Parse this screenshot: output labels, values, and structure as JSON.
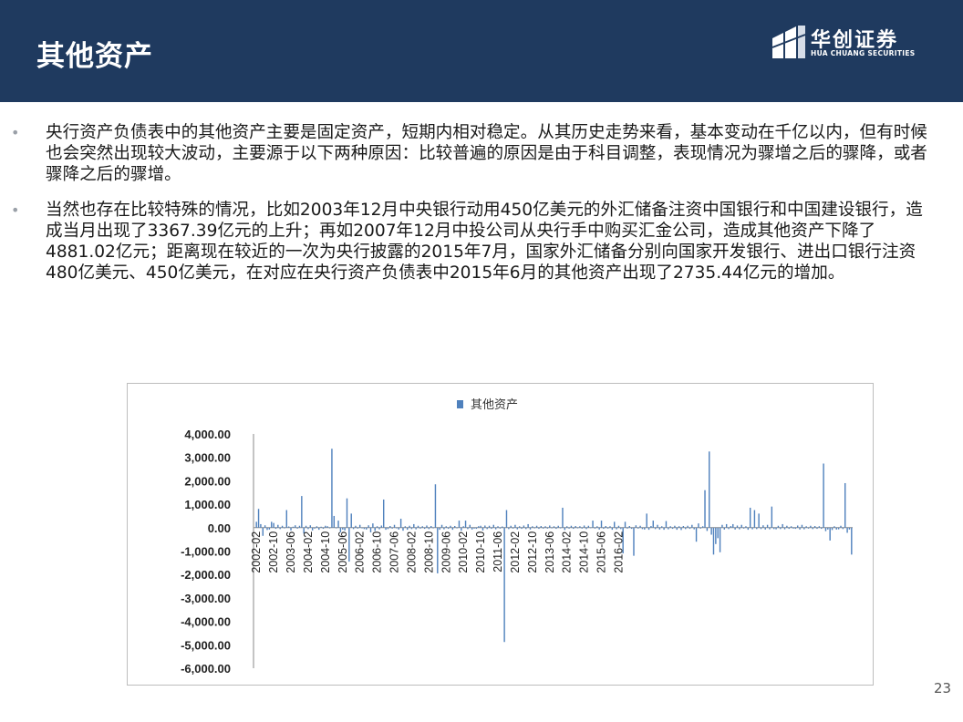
{
  "header": {
    "title": "其他资产",
    "logo_cn": "华创证券",
    "logo_en": "HUA CHUANG SECURITIES",
    "bg_color": "#1f3a5f"
  },
  "bullets": [
    {
      "text": "央行资产负债表中的其他资产主要是固定资产，短期内相对稳定。从其历史走势来看，基本变动在千亿以内，但有时候也会突然出现较大波动，主要源于以下两种原因：比较普遍的原因是由于科目调整，表现情况为骤增之后的骤降，或者骤降之后的骤增。"
    },
    {
      "text": "当然也存在比较特殊的情况，比如2003年12月中央银行动用450亿美元的外汇储备注资中国银行和中国建设银行，造成当月出现了3367.39亿元的上升；再如2007年12月中投公司从央行手中购买汇金公司，造成其他资产下降了4881.02亿元；距离现在较近的一次为央行披露的2015年7月，国家外汇储备分别向国家开发银行、进出口银行注资480亿美元、450亿美元，在对应在央行资产负债表中2015年6月的其他资产出现了2735.44亿元的增加。"
    }
  ],
  "page_number": "23",
  "chart_data": {
    "type": "bar",
    "title": "",
    "legend": [
      "其他资产"
    ],
    "legend_position": "top-center",
    "color": "#4f81bd",
    "grid": false,
    "ylim": [
      -6000,
      4000
    ],
    "yticks": [
      "4,000.00",
      "3,000.00",
      "2,000.00",
      "1,000.00",
      "0.00",
      "-1,000.00",
      "-2,000.00",
      "-3,000.00",
      "-4,000.00",
      "-5,000.00",
      "-6,000.00"
    ],
    "ytick_values": [
      4000,
      3000,
      2000,
      1000,
      0,
      -1000,
      -2000,
      -3000,
      -4000,
      -5000,
      -6000
    ],
    "x_start": "2002-02",
    "x_tick_labels": [
      "2002-02",
      "2002-10",
      "2003-06",
      "2004-02",
      "2004-10",
      "2005-06",
      "2006-02",
      "2006-10",
      "2007-06",
      "2008-02",
      "2008-10",
      "2009-06",
      "2010-02",
      "2010-10",
      "2011-06",
      "2012-02",
      "2012-10",
      "2013-06",
      "2014-02",
      "2014-10",
      "2015-06",
      "2016-02"
    ],
    "series": [
      {
        "name": "其他资产",
        "values": [
          250,
          800,
          150,
          -350,
          100,
          -100,
          -80,
          250,
          200,
          -50,
          120,
          -60,
          80,
          -30,
          750,
          50,
          -120,
          40,
          100,
          -40,
          80,
          1350,
          -250,
          80,
          -60,
          100,
          -120,
          -40,
          60,
          -90,
          40,
          -50,
          80,
          60,
          -30,
          3367.39,
          500,
          -30,
          300,
          -200,
          -80,
          -120,
          1250,
          -1450,
          600,
          -60,
          80,
          -40,
          120,
          -30,
          -60,
          -80,
          100,
          -200,
          180,
          -140,
          60,
          -70,
          90,
          1200,
          -90,
          -60,
          70,
          -40,
          120,
          -30,
          -80,
          380,
          -130,
          60,
          -90,
          80,
          -60,
          150,
          -70,
          80,
          -40,
          60,
          -50,
          90,
          -60,
          70,
          -30,
          1850,
          -1950,
          -90,
          120,
          -70,
          60,
          -50,
          80,
          -90,
          70,
          -30,
          300,
          -130,
          60,
          300,
          -60,
          120,
          -80,
          -40,
          -50,
          60,
          80,
          -120,
          90,
          -60,
          80,
          -50,
          120,
          -70,
          60,
          -40,
          50,
          -4881.02,
          750,
          -60,
          80,
          -40,
          120,
          -70,
          60,
          -50,
          90,
          -60,
          150,
          -80,
          60,
          -30,
          80,
          -50,
          70,
          -40,
          60,
          -40,
          90,
          -30,
          60,
          -50,
          80,
          -30,
          850,
          -100,
          60,
          -40,
          80,
          -50,
          70,
          -30,
          60,
          -40,
          90,
          -60,
          80,
          -20,
          300,
          -40,
          60,
          -80,
          300,
          -50,
          70,
          -40,
          60,
          -90,
          250,
          -70,
          80,
          -60,
          -1100,
          250,
          -40,
          70,
          -50,
          -1200,
          100,
          -40,
          80,
          -60,
          -80,
          600,
          -90,
          70,
          300,
          -60,
          120,
          -80,
          60,
          -90,
          280,
          -70,
          60,
          -50,
          80,
          -90,
          60,
          -100,
          70,
          -60,
          80,
          -50,
          120,
          -70,
          -600,
          180,
          -40,
          60,
          1600,
          -140,
          3250,
          -300,
          -1150,
          -700,
          -450,
          -1050,
          120,
          -80,
          150,
          -60,
          70,
          150,
          -80,
          90,
          -70,
          120,
          -40,
          60,
          -90,
          850,
          -70,
          750,
          -60,
          600,
          -60,
          100,
          -80,
          120,
          -70,
          900,
          -60,
          -70,
          80,
          -60,
          150,
          -70,
          80,
          -50,
          60,
          -40,
          -50,
          90,
          -80,
          120,
          -70,
          60,
          -40,
          80,
          -60,
          70,
          -50,
          60,
          -50,
          2735.44,
          -150,
          -80,
          -550,
          -100,
          60,
          -80,
          -70,
          80,
          -60,
          1900,
          -220,
          -80,
          -1150
        ]
      }
    ]
  }
}
